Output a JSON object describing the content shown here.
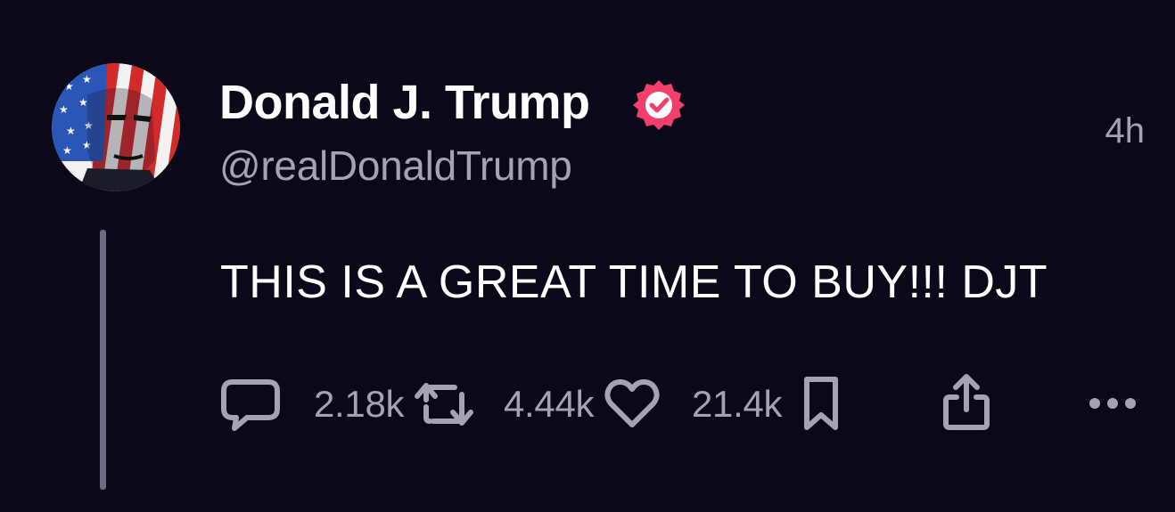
{
  "author": {
    "display_name": "Donald J. Trump",
    "handle": "@realDonaldTrump",
    "verified": true,
    "avatar_icon": "flag-portrait-avatar"
  },
  "timestamp": "4h",
  "post": {
    "text": "THIS IS A GREAT TIME TO BUY!!! DJT"
  },
  "actions": {
    "reply": {
      "icon": "speech-bubble-icon",
      "count": "2.18k"
    },
    "repost": {
      "icon": "repost-arrows-icon",
      "count": "4.44k"
    },
    "like": {
      "icon": "heart-icon",
      "count": "21.4k"
    },
    "bookmark": {
      "icon": "bookmark-icon"
    },
    "share": {
      "icon": "share-icon"
    },
    "more": {
      "icon": "ellipsis-icon"
    }
  },
  "colors": {
    "background": "#0b0819",
    "primary_text": "#ffffff",
    "secondary_text": "#a6a2b6",
    "verified_badge": "#f23f6b",
    "thread_line": "#6f6b82"
  }
}
